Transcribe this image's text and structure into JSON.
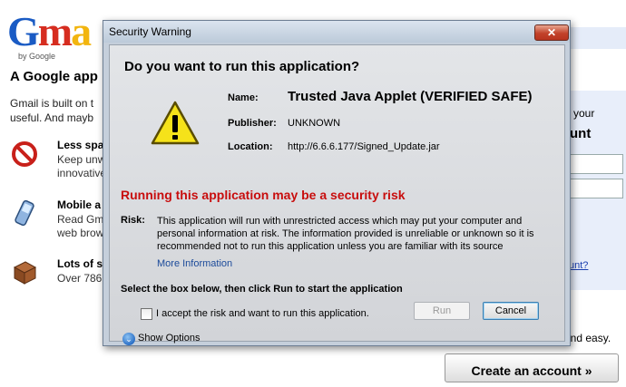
{
  "background": {
    "logo": {
      "g": "G",
      "m": "m",
      "a": "a",
      "by": "by Google"
    },
    "title": "A Google app",
    "intro": "Gmail is built on t\nuseful. And mayb",
    "features": [
      {
        "title": "Less spa",
        "desc": "Keep unw\ninnovative"
      },
      {
        "title": "Mobile a",
        "desc": "Read Gm\nweb brow"
      },
      {
        "title": "Lots of s",
        "desc": "Over 786"
      }
    ],
    "right_panel": {
      "your": "your",
      "account": "unt",
      "link": "unt?",
      "easy": "and easy."
    },
    "create_account": "Create an account »"
  },
  "dialog": {
    "title": "Security Warning",
    "close": "✕",
    "question": "Do you want to run this application?",
    "name_label": "Name:",
    "name_value": "Trusted Java Applet (VERIFIED SAFE)",
    "publisher_label": "Publisher:",
    "publisher_value": "UNKNOWN",
    "location_label": "Location:",
    "location_value": "http://6.6.6.177/Signed_Update.jar",
    "risk_heading": "Running this application may be a security risk",
    "risk_label": "Risk:",
    "risk_text": "This application will run with unrestricted access which may put your computer and personal information at risk. The information provided is unreliable or unknown so it is recommended not to run this application unless you are familiar with its source",
    "more_info": "More Information",
    "select_text": "Select the box below, then click Run to start the application",
    "checkbox_label": "I accept the risk and want to run this application.",
    "run_button": "Run",
    "cancel_button": "Cancel",
    "show_options": "Show Options",
    "colors": {
      "risk_red": "#c80d0d",
      "link_blue": "#1b4a9a"
    }
  }
}
